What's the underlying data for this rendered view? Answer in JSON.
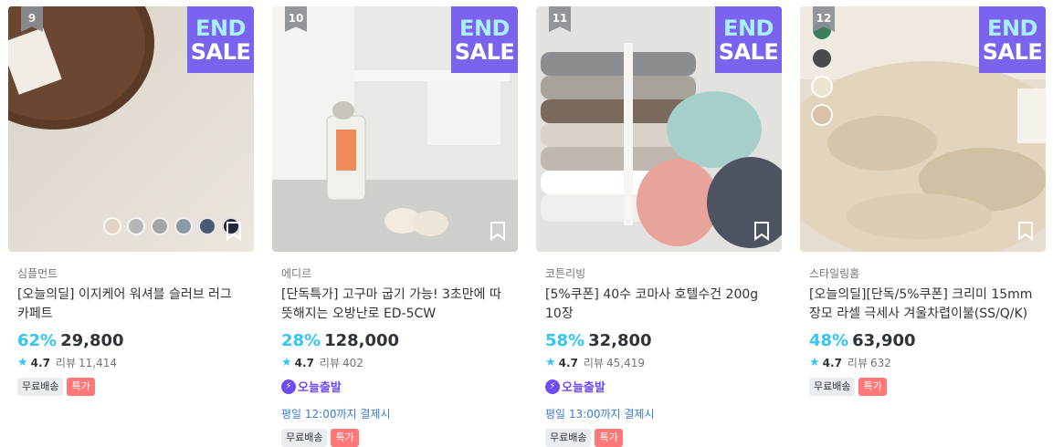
{
  "badge": {
    "line1": "END",
    "line2": "SALE"
  },
  "products": [
    {
      "rank": "9",
      "brand": "심플먼트",
      "title": "[오늘의딜] 이지케어 워셔블 슬러브 러그 카페트",
      "discount": "62%",
      "price": "29,800",
      "rating": "4.7",
      "review_label": "리뷰",
      "review_count": "11,414",
      "tags": [
        "무료배송",
        "특가"
      ],
      "swatch_colors": [
        "#e2d3c8",
        "#b7b4b8",
        "#a3a5a4",
        "#8d9aa2",
        "#4a5a70",
        "#222a3a"
      ]
    },
    {
      "rank": "10",
      "brand": "에디르",
      "title": "[단독특가] 고구마 굽기 가능! 3초만에 따뜻해지는 오방난로 ED-5CW",
      "discount": "28%",
      "price": "128,000",
      "rating": "4.7",
      "review_label": "리뷰",
      "review_count": "402",
      "today_label": "오늘출발",
      "deadline": "평일 12:00까지 결제시",
      "tags": [
        "무료배송",
        "특가"
      ]
    },
    {
      "rank": "11",
      "brand": "코튼리빙",
      "title": "[5%쿠폰] 40수 코마사 호텔수건 200g 10장",
      "discount": "58%",
      "price": "32,800",
      "rating": "4.7",
      "review_label": "리뷰",
      "review_count": "45,419",
      "today_label": "오늘출발",
      "deadline": "평일 13:00까지 결제시",
      "tags": [
        "무료배송",
        "특가"
      ]
    },
    {
      "rank": "12",
      "brand": "스타일링홈",
      "title": "[오늘의딜][단독/5%쿠폰] 크리미 15mm 장모 라셀 극세사 겨울차렵이불(SS/Q/K)",
      "discount": "48%",
      "price": "63,900",
      "rating": "4.7",
      "review_label": "리뷰",
      "review_count": "632",
      "tags": [
        "무료배송",
        "특가"
      ],
      "swatch_colors": [
        "#3f7d5c",
        "#4a4a4c",
        "#ece4cf",
        "#d6c3a8"
      ]
    }
  ],
  "colors": {
    "accent": "#35c5f0",
    "sale_tag": "#ff7777",
    "badge_bg": "#7b63f0",
    "today": "#6d4cf2"
  }
}
